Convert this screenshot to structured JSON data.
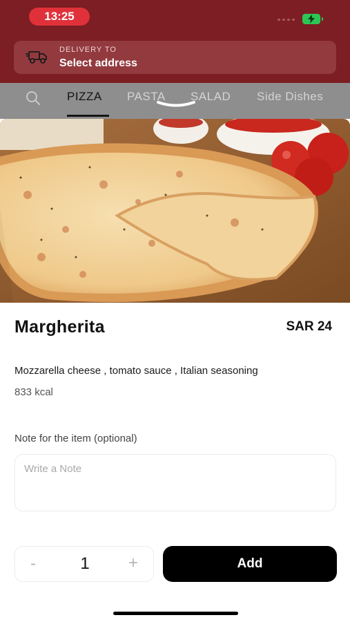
{
  "status_bar": {
    "time": "13:25"
  },
  "delivery": {
    "label": "DELIVERY TO",
    "address": "Select address"
  },
  "tabs": [
    {
      "label": "PIZZA",
      "active": true
    },
    {
      "label": "PASTA",
      "active": false
    },
    {
      "label": "SALAD",
      "active": false
    },
    {
      "label": "Side Dishes",
      "active": false
    }
  ],
  "item": {
    "name": "Margherita",
    "price": "SAR 24",
    "description": "Mozzarella cheese , tomato sauce , Italian seasoning",
    "calories": "833 kcal"
  },
  "note": {
    "label": "Note for the item (optional)",
    "placeholder": "Write a Note"
  },
  "quantity": {
    "minus": "-",
    "value": "1",
    "plus": "+"
  },
  "add_button": "Add",
  "colors": {
    "header_red": "#7c1e23",
    "time_pill": "#e0313a",
    "battery": "#2dc654",
    "button": "#000000"
  }
}
